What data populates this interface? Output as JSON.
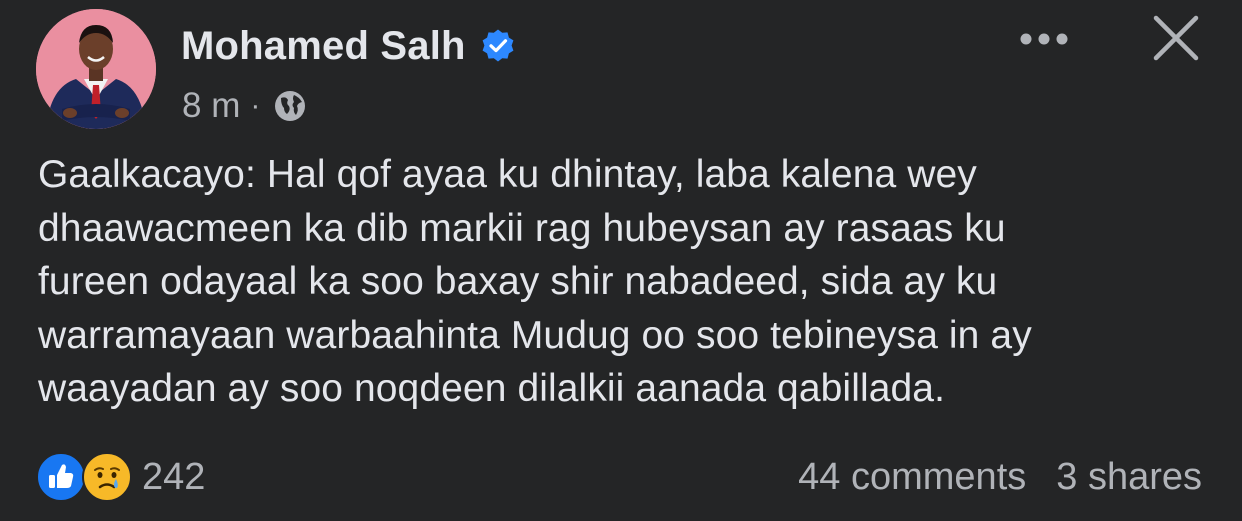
{
  "post": {
    "author": {
      "name": "Mohamed Salh",
      "verified": true,
      "avatar_bg": "#ea8fa0"
    },
    "time": "8 m",
    "separator": "·",
    "audience_icon": "globe-icon",
    "text_lines": [
      "Gaalkacayo: Hal qof ayaa ku dhintay, laba kalena wey",
      "dhaawacmeen ka dib markii rag hubeysan ay rasaas ku",
      "fureen odayaal ka soo baxay shir nabadeed, sida ay ku",
      "warramayaan warbaahinta Mudug oo soo tebineysa in ay",
      "waayadan ay soo noqdeen dilalkii aanada qabillada."
    ],
    "reactions": {
      "icons": [
        "like-icon",
        "sad-icon"
      ],
      "count": "242"
    },
    "comments": "44 comments",
    "shares": "3 shares"
  },
  "colors": {
    "background": "#242526",
    "primary_text": "#e4e6eb",
    "secondary_text": "#b0b3b8",
    "verified_blue": "#2d88ff",
    "like_blue": "#1877f2"
  }
}
